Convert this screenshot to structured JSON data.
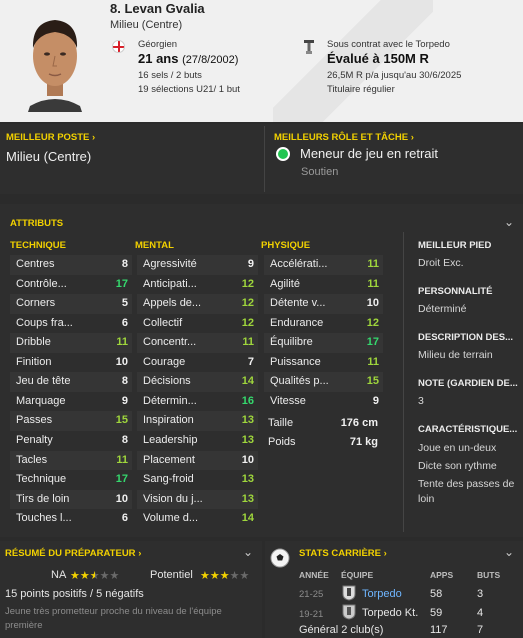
{
  "header": {
    "name": "8. Levan Gvalia",
    "position": "Milieu (Centre)",
    "nationality": "Géorgien",
    "age": "21 ans",
    "dob": "(27/8/2002)",
    "club_stats": "16 sels / 2 buts",
    "u21_stats": "19 sélections U21/ 1 but",
    "contract": "Sous contrat avec le Torpedo",
    "value": "Évalué à 150M R",
    "wage": "26,5M R p/a jusqu'au 30/6/2025",
    "status": "Titulaire régulier"
  },
  "best_position": {
    "title": "MEILLEUR POSTE",
    "value": "Milieu (Centre)"
  },
  "best_role": {
    "title": "MEILLEURS RÔLE ET TÂCHE",
    "role": "Meneur de jeu en retrait",
    "duty": "Soutien"
  },
  "attributes": {
    "title": "ATTRIBUTS",
    "technique": {
      "title": "TECHNIQUE",
      "items": [
        {
          "name": "Centres",
          "value": "8"
        },
        {
          "name": "Contrôle...",
          "value": "17"
        },
        {
          "name": "Corners",
          "value": "5"
        },
        {
          "name": "Coups fra...",
          "value": "6"
        },
        {
          "name": "Dribble",
          "value": "11"
        },
        {
          "name": "Finition",
          "value": "10"
        },
        {
          "name": "Jeu de tête",
          "value": "8"
        },
        {
          "name": "Marquage",
          "value": "9"
        },
        {
          "name": "Passes",
          "value": "15"
        },
        {
          "name": "Penalty",
          "value": "8"
        },
        {
          "name": "Tacles",
          "value": "11"
        },
        {
          "name": "Technique",
          "value": "17"
        },
        {
          "name": "Tirs de loin",
          "value": "10"
        },
        {
          "name": "Touches l...",
          "value": "6"
        }
      ]
    },
    "mental": {
      "title": "MENTAL",
      "items": [
        {
          "name": "Agressivité",
          "value": "9"
        },
        {
          "name": "Anticipati...",
          "value": "12"
        },
        {
          "name": "Appels de...",
          "value": "12"
        },
        {
          "name": "Collectif",
          "value": "12"
        },
        {
          "name": "Concentr...",
          "value": "11"
        },
        {
          "name": "Courage",
          "value": "7"
        },
        {
          "name": "Décisions",
          "value": "14"
        },
        {
          "name": "Détermin...",
          "value": "16"
        },
        {
          "name": "Inspiration",
          "value": "13"
        },
        {
          "name": "Leadership",
          "value": "13"
        },
        {
          "name": "Placement",
          "value": "10"
        },
        {
          "name": "Sang-froid",
          "value": "13"
        },
        {
          "name": "Vision du j...",
          "value": "13"
        },
        {
          "name": "Volume d...",
          "value": "14"
        }
      ]
    },
    "physique": {
      "title": "PHYSIQUE",
      "items": [
        {
          "name": "Accélérati...",
          "value": "11"
        },
        {
          "name": "Agilité",
          "value": "11"
        },
        {
          "name": "Détente v...",
          "value": "10"
        },
        {
          "name": "Endurance",
          "value": "12"
        },
        {
          "name": "Équilibre",
          "value": "17"
        },
        {
          "name": "Puissance",
          "value": "11"
        },
        {
          "name": "Qualités p...",
          "value": "15"
        },
        {
          "name": "Vitesse",
          "value": "9"
        }
      ],
      "height_label": "Taille",
      "height": "176 cm",
      "weight_label": "Poids",
      "weight": "71 kg"
    },
    "side": [
      {
        "title": "MEILLEUR PIED",
        "value": "Droit Exc."
      },
      {
        "title": "PERSONNALITÉ",
        "value": "Déterminé"
      },
      {
        "title": "DESCRIPTION DES...",
        "value": "Milieu de terrain"
      },
      {
        "title": "NOTE (GARDIEN DE...",
        "value": "3"
      },
      {
        "title": "CARACTÉRISTIQUE...",
        "value": "Joue en un-deux",
        "value2": "Dicte son rythme",
        "value3": "Tente des passes de",
        "value4": "loin"
      }
    ]
  },
  "coach_report": {
    "title": "RÉSUMÉ DU PRÉPARATEUR",
    "ability_label": "NA",
    "ability_stars": 2.5,
    "potential_label": "Potentiel",
    "potential_stars": 3,
    "summary": "15 points positifs / 5 négatifs",
    "note": "Jeune très prometteur proche du niveau de l'équipe",
    "note2": "première"
  },
  "career": {
    "title": "STATS CARRIÈRE",
    "headers": {
      "year": "ANNÉE",
      "team": "ÉQUIPE",
      "apps": "APPS",
      "goals": "BUTS"
    },
    "rows": [
      {
        "year": "21-25",
        "team": "Torpedo",
        "apps": "58",
        "goals": "3"
      },
      {
        "year": "19-21",
        "team": "Torpedo Kt.",
        "apps": "59",
        "goals": "4"
      }
    ],
    "total": {
      "label": "Général 2 club(s)",
      "apps": "117",
      "goals": "7"
    }
  },
  "colors": {
    "accent": "#f2d100",
    "good": "#9fd63c",
    "great": "#35d86d",
    "role_dot": "#23c552",
    "link": "#6fb6ff"
  }
}
